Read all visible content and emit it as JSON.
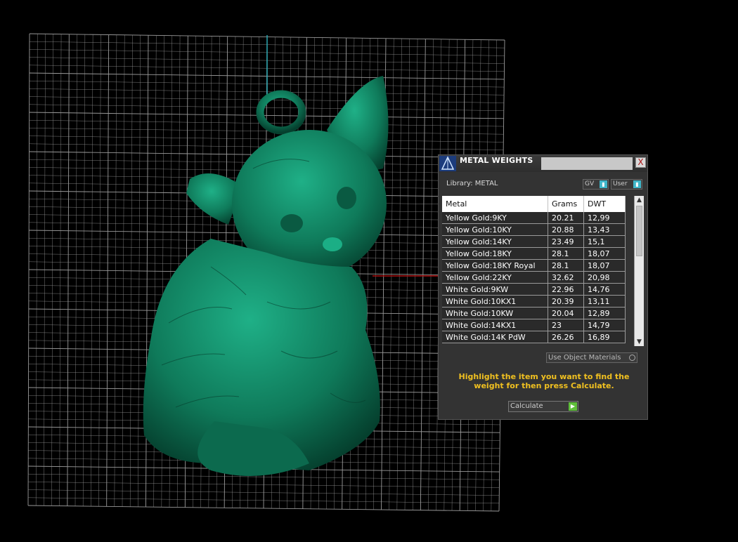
{
  "dialog": {
    "title": "METAL WEIGHTS",
    "close_label": "X",
    "library_label": "Library: METAL",
    "gv_label": "GV",
    "user_label": "User",
    "columns": [
      "Metal",
      "Grams",
      "DWT"
    ],
    "rows": [
      [
        "Yellow Gold:9KY",
        "20.21",
        "12,99"
      ],
      [
        "Yellow Gold:10KY",
        "20.88",
        "13,43"
      ],
      [
        "Yellow Gold:14KY",
        "23.49",
        "15,1"
      ],
      [
        "Yellow Gold:18KY",
        "28.1",
        "18,07"
      ],
      [
        "Yellow Gold:18KY Royal",
        "28.1",
        "18,07"
      ],
      [
        "Yellow Gold:22KY",
        "32.62",
        "20,98"
      ],
      [
        "White Gold:9KW",
        "22.96",
        "14,76"
      ],
      [
        "White Gold:10KX1",
        "20.39",
        "13,11"
      ],
      [
        "White Gold:10KW",
        "20.04",
        "12,89"
      ],
      [
        "White Gold:14KX1",
        "23",
        "14,79"
      ],
      [
        "White Gold:14K PdW",
        "26.26",
        "16,89"
      ]
    ],
    "use_object_materials": "Use Object Materials",
    "hint": "Highlight the item you want to find the weight for then press Calculate.",
    "calculate_label": "Calculate"
  },
  "colors": {
    "model": "#0f7a5a",
    "grid": "#9a9a9a",
    "axis_x": "#b01010",
    "axis_y": "#2aa7b0",
    "hint": "#f0c020"
  },
  "icons": [
    "app-logo-icon",
    "close-icon",
    "indicator-icon",
    "radio-icon",
    "play-icon",
    "scroll-up-icon",
    "scroll-down-icon"
  ]
}
